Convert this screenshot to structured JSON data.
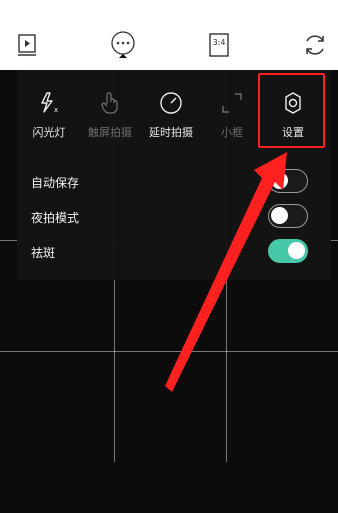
{
  "topbar": {
    "aspect_label": "3:4",
    "icons": [
      "video-mode-icon",
      "more-options-icon",
      "aspect-ratio-icon",
      "switch-camera-icon"
    ]
  },
  "tools": [
    {
      "label": "闪光灯",
      "icon": "flash-auto-icon",
      "enabled": true
    },
    {
      "label": "触屏拍摄",
      "icon": "touch-capture-icon",
      "enabled": false
    },
    {
      "label": "延时拍摄",
      "icon": "timer-icon",
      "enabled": true
    },
    {
      "label": "小框",
      "icon": "small-frame-icon",
      "enabled": false
    },
    {
      "label": "设置",
      "icon": "gear-icon",
      "enabled": true
    }
  ],
  "settings": [
    {
      "label": "自动保存",
      "state": "off"
    },
    {
      "label": "夜拍模式",
      "state": "off"
    },
    {
      "label": "祛斑",
      "state": "on"
    }
  ],
  "colors": {
    "toggle_on": "#46c8a9",
    "highlight": "#ff2020",
    "panel_bg": "#141414"
  }
}
